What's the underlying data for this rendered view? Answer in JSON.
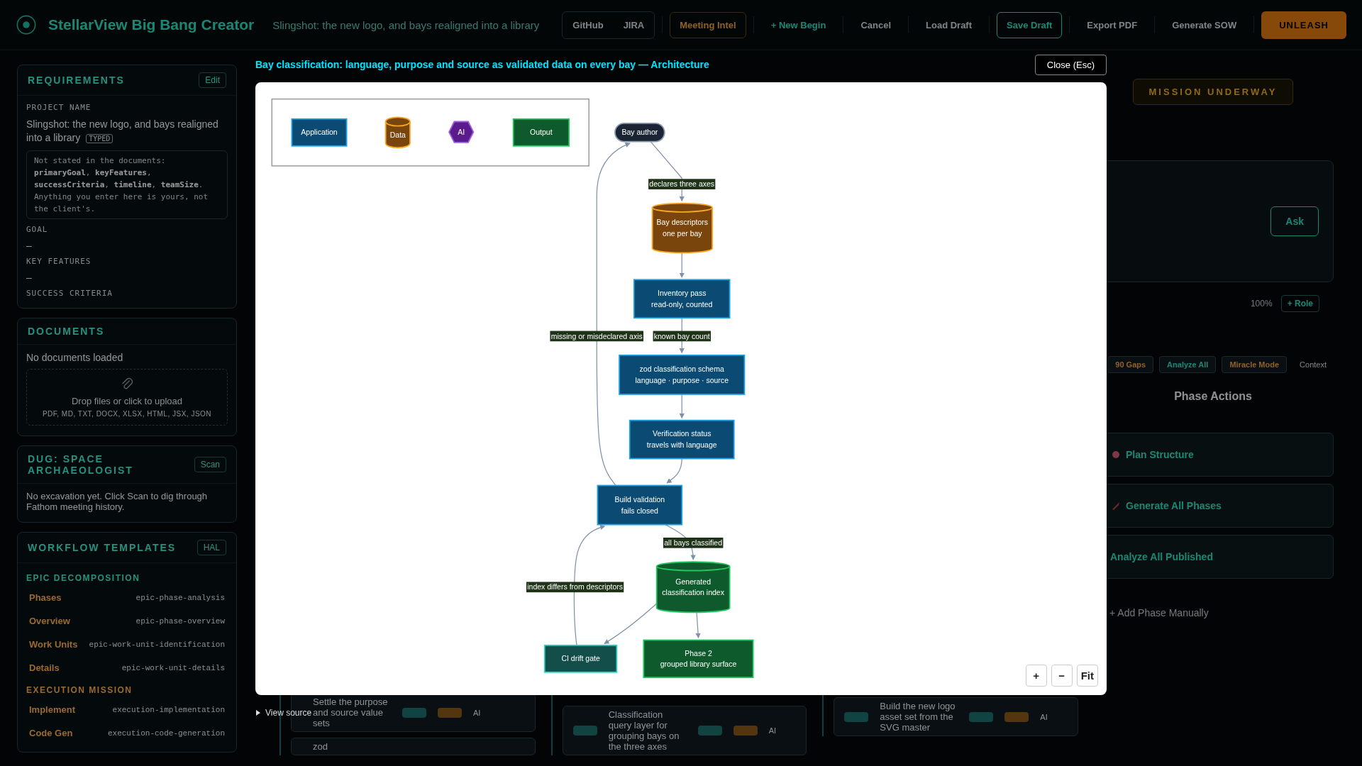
{
  "header": {
    "title": "StellarView Big Bang Creator",
    "project": "Slingshot: the new logo, and bays realigned into a library",
    "buttons": [
      {
        "label": "GitHub",
        "kind": "group"
      },
      {
        "label": "JIRA",
        "kind": "group"
      },
      {
        "label": "Meeting Intel",
        "kind": "warning"
      },
      {
        "label": "+ New Begin",
        "kind": "accent"
      },
      {
        "label": "Cancel",
        "kind": "plain"
      },
      {
        "label": "Load Draft",
        "kind": "plain"
      },
      {
        "label": "Save Draft",
        "kind": "outlined"
      },
      {
        "label": "Export PDF",
        "kind": "plain"
      },
      {
        "label": "Generate SOW",
        "kind": "plain"
      },
      {
        "label": "UNLEASH",
        "kind": "primary"
      }
    ]
  },
  "sidebar": {
    "requirements": {
      "title": "REQUIREMENTS",
      "edit": "Edit",
      "project_label": "PROJECT NAME",
      "project_name": "Slingshot: the new logo, and bays realigned into a library",
      "project_badge": "TYPED",
      "note": "Not stated in the documents: **primaryGoal**, **keyFeatures**, **successCriteria**, **timeline**, **teamSize**. Anything you enter here is yours, not the client's.",
      "fields": [
        {
          "label": "GOAL",
          "value": "–"
        },
        {
          "label": "KEY FEATURES",
          "value": "–"
        },
        {
          "label": "SUCCESS CRITERIA"
        }
      ]
    },
    "documents": {
      "title": "DOCUMENTS",
      "empty": "No documents loaded",
      "drop": "Drop files or click to upload",
      "formats": "PDF, MD, TXT, DOCX, XLSX, HTML, JSX, JSON"
    },
    "archaeologist": {
      "title": "DUG: SPACE ARCHAEOLOGIST",
      "button": "Scan",
      "text": "No excavation yet. Click Scan to dig through Fathom meeting history."
    },
    "templates": {
      "title": "WORKFLOW TEMPLATES",
      "button": "HAL",
      "groups": [
        {
          "name": "EPIC DECOMPOSITION",
          "items": [
            {
              "label": "Phases",
              "value": "epic-phase-analysis"
            },
            {
              "label": "Overview",
              "value": "epic-phase-overview"
            },
            {
              "label": "Work Units",
              "value": "epic-work-unit-identification"
            },
            {
              "label": "Details",
              "value": "epic-work-unit-details"
            }
          ]
        },
        {
          "name": "EXECUTION MISSION",
          "items": [
            {
              "label": "Implement",
              "value": "execution-implementation"
            },
            {
              "label": "Code Gen",
              "value": "execution-code-generation"
            }
          ]
        }
      ]
    }
  },
  "board": {
    "columns": [
      {
        "cards": [
          {
            "text": "Settle the purpose and source value sets",
            "tag": "AI"
          },
          {
            "text": "zod"
          }
        ]
      },
      {
        "cards": [
          {
            "text": "Classification query layer for grouping bays on the three axes",
            "tag": "AI"
          }
        ]
      },
      {
        "cards": [
          {
            "text": "Build the new logo asset set from the SVG master",
            "tag": "AI"
          }
        ]
      }
    ]
  },
  "rail": {
    "mission": "MISSION UNDERWAY",
    "ask": "Ask",
    "zoom_reading": "100%",
    "add_role": "+ Role",
    "actions": [
      {
        "label": "90 Gaps",
        "kind": "warning"
      },
      {
        "label": "Analyze All",
        "kind": "accent"
      },
      {
        "label": "Miracle Mode",
        "kind": "warning"
      },
      {
        "label": "Context",
        "kind": "plain"
      }
    ],
    "phase_actions": {
      "title": "Phase Actions",
      "items": [
        {
          "title": "Plan Structure",
          "kind": "plan"
        },
        {
          "title": "Generate All Phases",
          "kind": "generate"
        },
        {
          "title": "Analyze All Published",
          "kind": "analyze"
        }
      ],
      "add": "+ Add Phase Manually"
    }
  },
  "modal": {
    "title": "Bay classification: language, purpose and source as validated data on every bay — Architecture",
    "close": "Close (Esc)",
    "legend": [
      {
        "label": "Application",
        "kind": "application"
      },
      {
        "label": "Data",
        "kind": "data"
      },
      {
        "label": "AI",
        "kind": "ai"
      },
      {
        "label": "Output",
        "kind": "output"
      }
    ],
    "nodes": [
      {
        "lines": [
          "Bay author"
        ],
        "kind": "actor"
      },
      {
        "lines": [
          "Bay descriptors",
          "one per bay"
        ],
        "kind": "data"
      },
      {
        "lines": [
          "Inventory pass",
          "read-only, counted"
        ],
        "kind": "application"
      },
      {
        "lines": [
          "zod classification schema",
          "language · purpose · source"
        ],
        "kind": "application"
      },
      {
        "lines": [
          "Verification status",
          "travels with language"
        ],
        "kind": "application"
      },
      {
        "lines": [
          "Build validation",
          "fails closed"
        ],
        "kind": "application"
      },
      {
        "lines": [
          "Generated",
          "classification index"
        ],
        "kind": "output_data"
      },
      {
        "lines": [
          "CI drift gate"
        ],
        "kind": "gate"
      },
      {
        "lines": [
          "Phase 2",
          "grouped library surface"
        ],
        "kind": "output"
      }
    ],
    "edge_labels": [
      "declares three axes",
      "missing or misdeclared axis",
      "known bay count",
      "all bays classified",
      "index differs from descriptors"
    ],
    "zoom_controls": [
      "+",
      "−",
      "Fit"
    ],
    "source": {
      "label": "View source",
      "expanded": false
    }
  }
}
